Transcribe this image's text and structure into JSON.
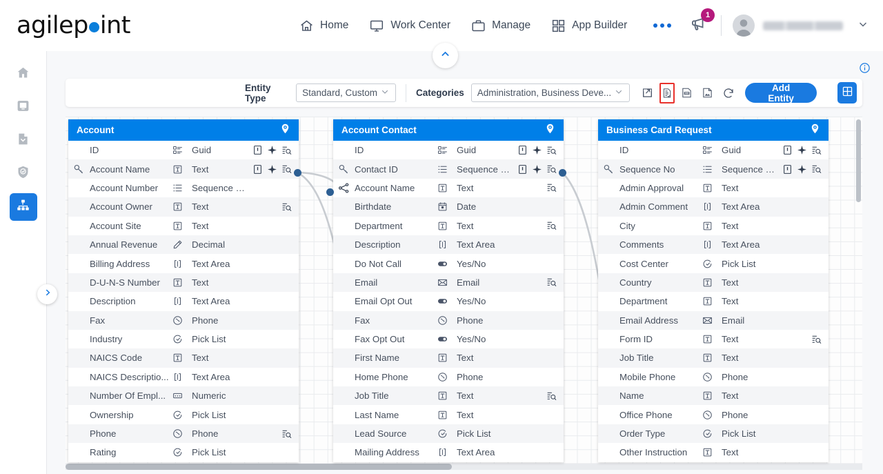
{
  "brand": {
    "name_a": "agilep",
    "name_b": "int"
  },
  "topnav": {
    "items": [
      {
        "label": "Home",
        "icon": "home-icon"
      },
      {
        "label": "Work Center",
        "icon": "monitor-icon"
      },
      {
        "label": "Manage",
        "icon": "briefcase-icon"
      },
      {
        "label": "App Builder",
        "icon": "grid-icon"
      }
    ],
    "more_label": "",
    "notification_count": "1",
    "user_name": ""
  },
  "rail": {
    "items": [
      {
        "name": "home",
        "icon": "home-icon",
        "active": false
      },
      {
        "name": "work-center",
        "icon": "monitor-icon",
        "active": false
      },
      {
        "name": "documents",
        "icon": "document-icon",
        "active": false
      },
      {
        "name": "security",
        "icon": "shield-check-icon",
        "active": false
      },
      {
        "name": "data-entities",
        "icon": "sitemap-icon",
        "active": true
      }
    ]
  },
  "toolbar": {
    "entity_type_label": "Entity Type",
    "entity_type_value": "Standard, Custom",
    "categories_label": "Categories",
    "categories_value": "Administration, Business Deve...",
    "icons": [
      {
        "name": "open-external-icon",
        "highlighted": false
      },
      {
        "name": "checklist-report-icon",
        "highlighted": true
      },
      {
        "name": "export-pdf-icon",
        "highlighted": false
      },
      {
        "name": "export-image-icon",
        "highlighted": false
      },
      {
        "name": "refresh-icon",
        "highlighted": false
      }
    ],
    "add_entity_label": "Add Entity",
    "layout_icon": "grid-layout-icon"
  },
  "entities": [
    {
      "title": "Account",
      "fields": [
        {
          "name": "ID",
          "type": "Guid",
          "type_icon": "guid-icon",
          "key": false,
          "rel": false,
          "required": true,
          "unique": true,
          "indexed": true
        },
        {
          "name": "Account Name",
          "type": "Text",
          "type_icon": "text-icon",
          "key": true,
          "rel": false,
          "required": true,
          "unique": true,
          "indexed": true,
          "anchor": true
        },
        {
          "name": "Account Number",
          "type": "Sequence Num...",
          "type_icon": "sequence-icon",
          "key": false,
          "rel": false,
          "required": false,
          "unique": false,
          "indexed": false
        },
        {
          "name": "Account Owner",
          "type": "Text",
          "type_icon": "text-icon",
          "key": false,
          "rel": false,
          "required": false,
          "unique": false,
          "indexed": true
        },
        {
          "name": "Account Site",
          "type": "Text",
          "type_icon": "text-icon",
          "key": false,
          "rel": false,
          "required": false,
          "unique": false,
          "indexed": false
        },
        {
          "name": "Annual Revenue",
          "type": "Decimal",
          "type_icon": "decimal-icon",
          "key": false,
          "rel": false,
          "required": false,
          "unique": false,
          "indexed": false
        },
        {
          "name": "Billing Address",
          "type": "Text Area",
          "type_icon": "textarea-icon",
          "key": false,
          "rel": false,
          "required": false,
          "unique": false,
          "indexed": false
        },
        {
          "name": "D-U-N-S Number",
          "type": "Text",
          "type_icon": "text-icon",
          "key": false,
          "rel": false,
          "required": false,
          "unique": false,
          "indexed": false
        },
        {
          "name": "Description",
          "type": "Text Area",
          "type_icon": "textarea-icon",
          "key": false,
          "rel": false,
          "required": false,
          "unique": false,
          "indexed": false
        },
        {
          "name": "Fax",
          "type": "Phone",
          "type_icon": "phone-icon",
          "key": false,
          "rel": false,
          "required": false,
          "unique": false,
          "indexed": false
        },
        {
          "name": "Industry",
          "type": "Pick List",
          "type_icon": "picklist-icon",
          "key": false,
          "rel": false,
          "required": false,
          "unique": false,
          "indexed": false
        },
        {
          "name": "NAICS Code",
          "type": "Text",
          "type_icon": "text-icon",
          "key": false,
          "rel": false,
          "required": false,
          "unique": false,
          "indexed": false
        },
        {
          "name": "NAICS Descriptio...",
          "type": "Text Area",
          "type_icon": "textarea-icon",
          "key": false,
          "rel": false,
          "required": false,
          "unique": false,
          "indexed": false
        },
        {
          "name": "Number Of Empl...",
          "type": "Numeric",
          "type_icon": "numeric-icon",
          "key": false,
          "rel": false,
          "required": false,
          "unique": false,
          "indexed": false
        },
        {
          "name": "Ownership",
          "type": "Pick List",
          "type_icon": "picklist-icon",
          "key": false,
          "rel": false,
          "required": false,
          "unique": false,
          "indexed": false
        },
        {
          "name": "Phone",
          "type": "Phone",
          "type_icon": "phone-icon",
          "key": false,
          "rel": false,
          "required": false,
          "unique": false,
          "indexed": true
        },
        {
          "name": "Rating",
          "type": "Pick List",
          "type_icon": "picklist-icon",
          "key": false,
          "rel": false,
          "required": false,
          "unique": false,
          "indexed": false
        }
      ]
    },
    {
      "title": "Account Contact",
      "fields": [
        {
          "name": "ID",
          "type": "Guid",
          "type_icon": "guid-icon",
          "key": false,
          "rel": false,
          "required": true,
          "unique": true,
          "indexed": true
        },
        {
          "name": "Contact ID",
          "type": "Sequence Num...",
          "type_icon": "sequence-icon",
          "key": true,
          "rel": false,
          "required": true,
          "unique": true,
          "indexed": true,
          "anchor": true
        },
        {
          "name": "Account Name",
          "type": "Text",
          "type_icon": "text-icon",
          "key": false,
          "rel": true,
          "required": false,
          "unique": false,
          "indexed": true
        },
        {
          "name": "Birthdate",
          "type": "Date",
          "type_icon": "date-icon",
          "key": false,
          "rel": false,
          "required": false,
          "unique": false,
          "indexed": false
        },
        {
          "name": "Department",
          "type": "Text",
          "type_icon": "text-icon",
          "key": false,
          "rel": false,
          "required": false,
          "unique": false,
          "indexed": true
        },
        {
          "name": "Description",
          "type": "Text Area",
          "type_icon": "textarea-icon",
          "key": false,
          "rel": false,
          "required": false,
          "unique": false,
          "indexed": false
        },
        {
          "name": "Do Not Call",
          "type": "Yes/No",
          "type_icon": "yesno-icon",
          "key": false,
          "rel": false,
          "required": false,
          "unique": false,
          "indexed": false
        },
        {
          "name": "Email",
          "type": "Email",
          "type_icon": "email-icon",
          "key": false,
          "rel": false,
          "required": false,
          "unique": false,
          "indexed": true
        },
        {
          "name": "Email Opt Out",
          "type": "Yes/No",
          "type_icon": "yesno-icon",
          "key": false,
          "rel": false,
          "required": false,
          "unique": false,
          "indexed": false
        },
        {
          "name": "Fax",
          "type": "Phone",
          "type_icon": "phone-icon",
          "key": false,
          "rel": false,
          "required": false,
          "unique": false,
          "indexed": false
        },
        {
          "name": "Fax Opt Out",
          "type": "Yes/No",
          "type_icon": "yesno-icon",
          "key": false,
          "rel": false,
          "required": false,
          "unique": false,
          "indexed": false
        },
        {
          "name": "First Name",
          "type": "Text",
          "type_icon": "text-icon",
          "key": false,
          "rel": false,
          "required": false,
          "unique": false,
          "indexed": false
        },
        {
          "name": "Home Phone",
          "type": "Phone",
          "type_icon": "phone-icon",
          "key": false,
          "rel": false,
          "required": false,
          "unique": false,
          "indexed": false
        },
        {
          "name": "Job Title",
          "type": "Text",
          "type_icon": "text-icon",
          "key": false,
          "rel": false,
          "required": false,
          "unique": false,
          "indexed": true
        },
        {
          "name": "Last Name",
          "type": "Text",
          "type_icon": "text-icon",
          "key": false,
          "rel": false,
          "required": false,
          "unique": false,
          "indexed": false
        },
        {
          "name": "Lead Source",
          "type": "Pick List",
          "type_icon": "picklist-icon",
          "key": false,
          "rel": false,
          "required": false,
          "unique": false,
          "indexed": false
        },
        {
          "name": "Mailing Address",
          "type": "Text Area",
          "type_icon": "textarea-icon",
          "key": false,
          "rel": false,
          "required": false,
          "unique": false,
          "indexed": false
        }
      ]
    },
    {
      "title": "Business Card Request",
      "fields": [
        {
          "name": "ID",
          "type": "Guid",
          "type_icon": "guid-icon",
          "key": false,
          "rel": false,
          "required": true,
          "unique": true,
          "indexed": true
        },
        {
          "name": "Sequence No",
          "type": "Sequence Num...",
          "type_icon": "sequence-icon",
          "key": true,
          "rel": false,
          "required": true,
          "unique": true,
          "indexed": true
        },
        {
          "name": "Admin Approval",
          "type": "Text",
          "type_icon": "text-icon",
          "key": false,
          "rel": false,
          "required": false,
          "unique": false,
          "indexed": false
        },
        {
          "name": "Admin Comment",
          "type": "Text Area",
          "type_icon": "textarea-icon",
          "key": false,
          "rel": false,
          "required": false,
          "unique": false,
          "indexed": false
        },
        {
          "name": "City",
          "type": "Text",
          "type_icon": "text-icon",
          "key": false,
          "rel": false,
          "required": false,
          "unique": false,
          "indexed": false
        },
        {
          "name": "Comments",
          "type": "Text Area",
          "type_icon": "textarea-icon",
          "key": false,
          "rel": false,
          "required": false,
          "unique": false,
          "indexed": false
        },
        {
          "name": "Cost Center",
          "type": "Pick List",
          "type_icon": "picklist-icon",
          "key": false,
          "rel": false,
          "required": false,
          "unique": false,
          "indexed": false
        },
        {
          "name": "Country",
          "type": "Text",
          "type_icon": "text-icon",
          "key": false,
          "rel": false,
          "required": false,
          "unique": false,
          "indexed": false
        },
        {
          "name": "Department",
          "type": "Text",
          "type_icon": "text-icon",
          "key": false,
          "rel": false,
          "required": false,
          "unique": false,
          "indexed": false
        },
        {
          "name": "Email Address",
          "type": "Email",
          "type_icon": "email-icon",
          "key": false,
          "rel": false,
          "required": false,
          "unique": false,
          "indexed": false
        },
        {
          "name": "Form ID",
          "type": "Text",
          "type_icon": "text-icon",
          "key": false,
          "rel": false,
          "required": false,
          "unique": false,
          "indexed": true
        },
        {
          "name": "Job Title",
          "type": "Text",
          "type_icon": "text-icon",
          "key": false,
          "rel": false,
          "required": false,
          "unique": false,
          "indexed": false
        },
        {
          "name": "Mobile Phone",
          "type": "Phone",
          "type_icon": "phone-icon",
          "key": false,
          "rel": false,
          "required": false,
          "unique": false,
          "indexed": false
        },
        {
          "name": "Name",
          "type": "Text",
          "type_icon": "text-icon",
          "key": false,
          "rel": false,
          "required": false,
          "unique": false,
          "indexed": false
        },
        {
          "name": "Office Phone",
          "type": "Phone",
          "type_icon": "phone-icon",
          "key": false,
          "rel": false,
          "required": false,
          "unique": false,
          "indexed": false
        },
        {
          "name": "Order Type",
          "type": "Pick List",
          "type_icon": "picklist-icon",
          "key": false,
          "rel": false,
          "required": false,
          "unique": false,
          "indexed": false
        },
        {
          "name": "Other Instruction",
          "type": "Text",
          "type_icon": "text-icon",
          "key": false,
          "rel": false,
          "required": false,
          "unique": false,
          "indexed": false
        }
      ]
    }
  ],
  "colors": {
    "accent": "#1a7ae0",
    "card_header": "#007fe8",
    "highlight_box": "#e8312c",
    "badge": "#b5197c"
  }
}
